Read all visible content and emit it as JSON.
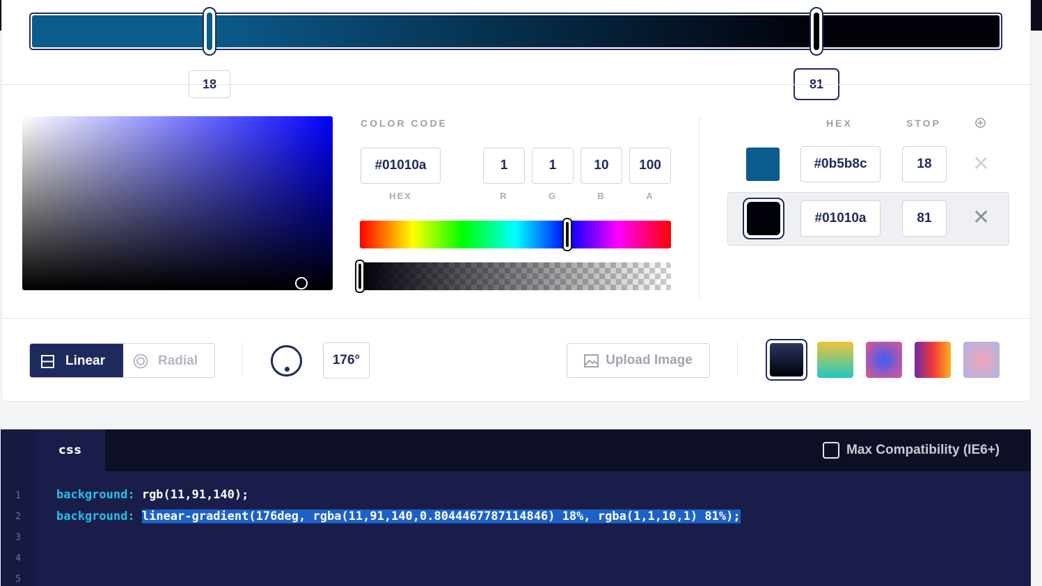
{
  "gradient": {
    "stops": [
      {
        "hex": "#0b5b8c",
        "stop": "18"
      },
      {
        "hex": "#01010a",
        "stop": "81"
      }
    ],
    "preview_css": "linear-gradient(90deg, #0b5b8c 18%, #01010a 81%)"
  },
  "picker": {
    "section_title": "COLOR CODE",
    "hex_value": "#01010a",
    "hex_label": "HEX",
    "r": "1",
    "g": "1",
    "b": "10",
    "a": "100",
    "r_label": "R",
    "g_label": "G",
    "b_label": "B",
    "a_label": "A",
    "hue_fraction": 0.667,
    "alpha_fraction": 1.0
  },
  "stops_table": {
    "hex_header": "HEX",
    "stop_header": "STOP",
    "add_icon": "plus-circle-icon",
    "remove_icon": "close-icon",
    "remove_glyph": "✕"
  },
  "toolbar": {
    "linear_label": "Linear",
    "radial_label": "Radial",
    "angle_value": "176°",
    "upload_label": "Upload Image",
    "presets": [
      {
        "name": "navy",
        "css": "linear-gradient(180deg,#2b3560,#01010a)"
      },
      {
        "name": "yellow-teal",
        "css": "linear-gradient(180deg,#f2c43a,#1ec8c0)"
      },
      {
        "name": "radial-blue-pink",
        "css": "radial-gradient(circle,#3e5ef5,#e2568c)"
      },
      {
        "name": "purple-orange",
        "css": "linear-gradient(90deg,#6a2ca8,#f0383a,#ffb020)"
      },
      {
        "name": "radial-pink-lavender",
        "css": "radial-gradient(circle,#f2a4b8,#a9b6e6)"
      }
    ]
  },
  "code": {
    "tab_label": "css",
    "compat_label": "Max Compatibility (IE6+)",
    "line_numbers": [
      "1",
      "2",
      "3",
      "4",
      "5"
    ],
    "line1_prop": "background:",
    "line1_value": " rgb(11,91,140);",
    "line2_prop": "background:",
    "line2_value": "linear-gradient(176deg, rgba(11,91,140,0.8044467787114846) 18%, rgba(1,1,10,1) 81%);"
  },
  "colors": {
    "accent": "#1e2a5e",
    "code_bg": "#1a1d4a",
    "keyword": "#21c4e8",
    "selection": "#1c61c7"
  }
}
